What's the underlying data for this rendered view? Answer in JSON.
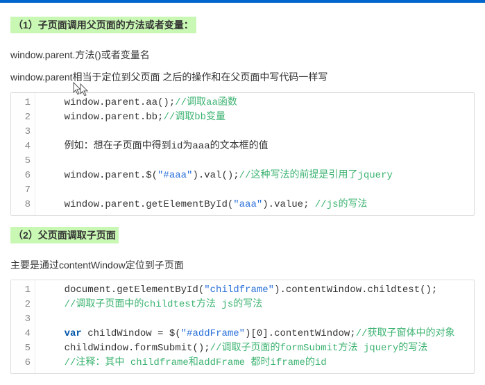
{
  "section1": {
    "title": "（1）子页面调用父页面的方法或者变量：",
    "line1": "window.parent.方法()或者变量名",
    "line2a": "window.parent",
    "line2b": "相当于定位到父页面  之后的操作和在父页面中写代码一样写"
  },
  "code1": {
    "lines": [
      "1",
      "2",
      "3",
      "4",
      "5",
      "6",
      "7",
      "8"
    ],
    "r1a": "    window.parent.aa();",
    "r1b": "//调取aa函数",
    "r2a": "    window.parent.bb;",
    "r2b": "//调取bb变量",
    "r3": "",
    "r4a": "    例如：想在子页面中得到id为aaa的文本框的值",
    "r5": "",
    "r6a": "    window.parent.$(",
    "r6b": "\"#aaa\"",
    "r6c": ").val();",
    "r6d": "//这种写法的前提是引用了jquery",
    "r7": "",
    "r8a": "    window.parent.getElementById(",
    "r8b": "\"aaa\"",
    "r8c": ").value; ",
    "r8d": "//js的写法"
  },
  "section2": {
    "title": "（2）父页面调取子页面",
    "line1": "主要是通过contentWindow定位到子页面"
  },
  "code2": {
    "lines": [
      "1",
      "2",
      "3",
      "4",
      "5",
      "6"
    ],
    "r1a": "    document.getElementById(",
    "r1b": "\"childframe\"",
    "r1c": ").contentWindow.childtest();",
    "r2a": "    ",
    "r2b": "//调取子页面中的childtest方法 js的写法",
    "r3": "",
    "r4a": "    ",
    "r4kw": "var",
    "r4b": " childWindow = $(",
    "r4c": "\"#addFrame\"",
    "r4d": ")[0].contentWindow;",
    "r4e": "//获取子窗体中的对象",
    "r5a": "    childWindow.formSubmit();",
    "r5b": "//调取子页面的formSubmit方法 jquery的写法",
    "r6a": "    ",
    "r6b": "//注释：其中 childframe和addFrame 都时iframe的id"
  }
}
